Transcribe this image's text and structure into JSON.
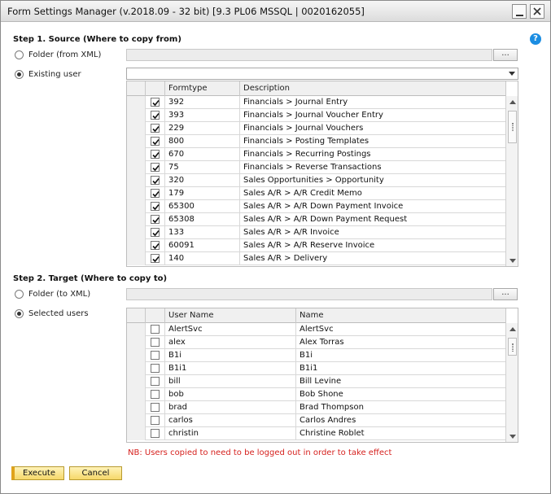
{
  "window": {
    "title": "Form Settings Manager (v.2018.09 - 32 bit) [9.3 PL06 MSSQL | 0020162055]",
    "help_icon_glyph": "?"
  },
  "step1": {
    "label": "Step 1. Source (Where to copy from)",
    "folder_option": "Folder (from XML)",
    "user_option": "Existing user",
    "selected_option": "user",
    "folder_path": "",
    "browse_label": "...",
    "user_selected": "",
    "columns": [
      "Formtype",
      "Description"
    ],
    "rows": [
      {
        "checked": true,
        "formtype": "392",
        "description": "Financials > Journal Entry"
      },
      {
        "checked": true,
        "formtype": "393",
        "description": "Financials > Journal Voucher Entry"
      },
      {
        "checked": true,
        "formtype": "229",
        "description": "Financials > Journal Vouchers"
      },
      {
        "checked": true,
        "formtype": "800",
        "description": "Financials > Posting Templates"
      },
      {
        "checked": true,
        "formtype": "670",
        "description": "Financials > Recurring Postings"
      },
      {
        "checked": true,
        "formtype": "75",
        "description": "Financials > Reverse Transactions"
      },
      {
        "checked": true,
        "formtype": "320",
        "description": "Sales Opportunities > Opportunity"
      },
      {
        "checked": true,
        "formtype": "179",
        "description": "Sales A/R > A/R Credit Memo"
      },
      {
        "checked": true,
        "formtype": "65300",
        "description": "Sales A/R > A/R Down Payment Invoice"
      },
      {
        "checked": true,
        "formtype": "65308",
        "description": "Sales A/R > A/R Down Payment Request"
      },
      {
        "checked": true,
        "formtype": "133",
        "description": "Sales A/R > A/R Invoice"
      },
      {
        "checked": true,
        "formtype": "60091",
        "description": "Sales A/R > A/R Reserve Invoice"
      },
      {
        "checked": true,
        "formtype": "140",
        "description": "Sales A/R > Delivery"
      }
    ]
  },
  "step2": {
    "label": "Step 2. Target (Where to copy to)",
    "folder_option": "Folder (to XML)",
    "users_option": "Selected users",
    "selected_option": "users",
    "folder_path": "",
    "browse_label": "...",
    "columns": [
      "User Name",
      "Name"
    ],
    "rows": [
      {
        "checked": false,
        "username": "AlertSvc",
        "name": "AlertSvc"
      },
      {
        "checked": false,
        "username": "alex",
        "name": "Alex Torras"
      },
      {
        "checked": false,
        "username": "B1i",
        "name": "B1i"
      },
      {
        "checked": false,
        "username": "B1i1",
        "name": "B1i1"
      },
      {
        "checked": false,
        "username": "bill",
        "name": "Bill Levine"
      },
      {
        "checked": false,
        "username": "bob",
        "name": "Bob Shone"
      },
      {
        "checked": false,
        "username": "brad",
        "name": "Brad Thompson"
      },
      {
        "checked": false,
        "username": "carlos",
        "name": "Carlos Andres"
      },
      {
        "checked": false,
        "username": "christin",
        "name": "Christine Roblet"
      }
    ],
    "note": "NB: Users copied to need to be logged out in order to take effect"
  },
  "actions": {
    "execute_label": "Execute",
    "cancel_label": "Cancel"
  },
  "colors": {
    "note_red": "#d6221f",
    "help_blue": "#1b8de2",
    "button_yellow": "#f6d86a"
  }
}
